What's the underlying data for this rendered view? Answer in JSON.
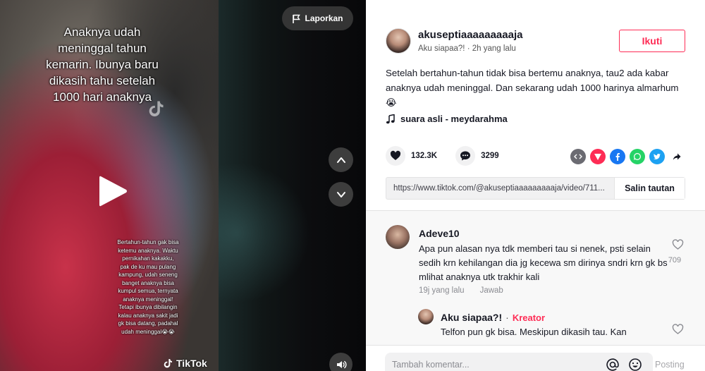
{
  "video": {
    "overlay_title": "Anaknya udah\nmeninggal tahun\nkemarin. Ibunya baru\ndikasih tahu setelah\n1000 hari anaknya",
    "overlay_caption": "Bertahun-tahun gak bisa\nketemu anaknya. Waktu\npernikahan kakakku,\npak de ku mau pulang\nkampung, udah seneng\nbanget anaknya bisa\nkumpul semua, ternyata\nanaknya meninggal!\nTetapi ibunya dibilangin\nkalau anaknya sakit jadi\ngk bisa datang, padahal\nudah meninggal😭😭",
    "watermark": "TikTok",
    "report_label": "Laporkan"
  },
  "author": {
    "username": "akuseptiaaaaaaaaaja",
    "nickname": "Aku siapaa?!",
    "separator": "·",
    "posted": "2h yang lalu",
    "follow_label": "Ikuti"
  },
  "description": "Setelah bertahun-tahun tidak bisa bertemu anaknya, tau2 ada kabar anaknya udah meninggal. Dan sekarang udah 1000 harinya almarhum 😭",
  "music": "suara asli - meydarahma",
  "stats": {
    "likes": "132.3K",
    "comments": "3299"
  },
  "share_icons": [
    {
      "name": "embed-icon",
      "color": "#6b6b72"
    },
    {
      "name": "send-to-friends-icon",
      "color": "#fe2c55"
    },
    {
      "name": "facebook-icon",
      "color": "#1877f2"
    },
    {
      "name": "whatsapp-icon",
      "color": "#25d366"
    },
    {
      "name": "twitter-icon",
      "color": "#1da1f2"
    },
    {
      "name": "share-arrow-icon",
      "color": "#161823"
    }
  ],
  "link": {
    "url": "https://www.tiktok.com/@akuseptiaaaaaaaaaja/video/711...",
    "copy_label": "Salin tautan"
  },
  "comments": [
    {
      "name": "Adeve10",
      "text": "Apa pun alasan nya tdk memberi tau si nenek, psti selain sedih krn kehilangan dia jg kecewa sm dirinya sndri krn gk bs mlihat anaknya utk trakhir kali",
      "time": "19j yang lalu",
      "reply_label": "Jawab",
      "likes": "709"
    },
    {
      "name": "Aku siapaa?!",
      "separator": "·",
      "badge": "Kreator",
      "text": "Telfon pun gk bisa. Meskipun dikasih tau. Kan"
    }
  ],
  "comment_bar": {
    "placeholder": "Tambah komentar...",
    "post_label": "Posting"
  }
}
